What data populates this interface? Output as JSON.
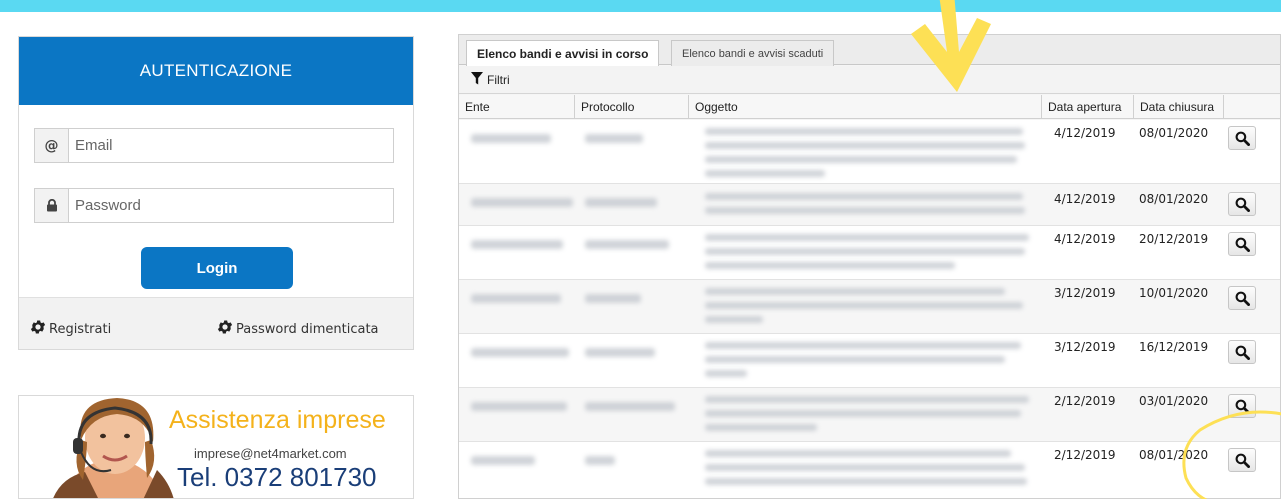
{
  "colors": {
    "background": "#5ad9f2",
    "primary": "#0b76c4",
    "support_title": "#f4b21b",
    "support_phone": "#1a3e78",
    "annotation": "#fde055"
  },
  "login": {
    "header": "AUTENTICAZIONE",
    "email_icon": "@",
    "email_placeholder": "Email",
    "password_icon_name": "lock-icon",
    "password_placeholder": "Password",
    "login_label": "Login",
    "register_label": "Registrati",
    "forgot_label": "Password dimenticata",
    "footer_icon_name": "gear-icon"
  },
  "support": {
    "title": "Assistenza imprese",
    "email": "imprese@net4market.com",
    "phone": "Tel. 0372 801730",
    "image_name": "support-operator-headset"
  },
  "tabs": [
    {
      "label": "Elenco bandi e avvisi in corso",
      "active": true
    },
    {
      "label": "Elenco bandi e avvisi scaduti",
      "active": false
    }
  ],
  "toolbar": {
    "filter_label": "Filtri",
    "filter_icon_name": "filter-icon"
  },
  "table": {
    "columns": [
      "Ente",
      "Protocollo",
      "Oggetto",
      "Data apertura",
      "Data chiusura",
      ""
    ],
    "rows": [
      {
        "data_apertura": "4/12/2019",
        "data_chiusura": "08/01/2020",
        "oggetto_lines": 4
      },
      {
        "data_apertura": "4/12/2019",
        "data_chiusura": "08/01/2020",
        "oggetto_lines": 2
      },
      {
        "data_apertura": "4/12/2019",
        "data_chiusura": "20/12/2019",
        "oggetto_lines": 3
      },
      {
        "data_apertura": "3/12/2019",
        "data_chiusura": "10/01/2020",
        "oggetto_lines": 3
      },
      {
        "data_apertura": "3/12/2019",
        "data_chiusura": "16/12/2019",
        "oggetto_lines": 3
      },
      {
        "data_apertura": "2/12/2019",
        "data_chiusura": "03/01/2020",
        "oggetto_lines": 3
      },
      {
        "data_apertura": "2/12/2019",
        "data_chiusura": "08/01/2020",
        "oggetto_lines": 3
      }
    ],
    "row_action_icon_name": "magnifier-icon"
  }
}
